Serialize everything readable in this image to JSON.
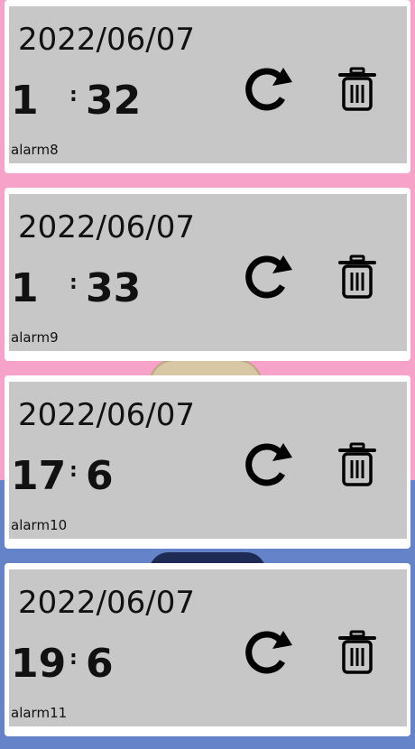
{
  "alarms": [
    {
      "date": "2022/06/07",
      "hour": "1",
      "separator": ":",
      "minute": "32",
      "label": "alarm8"
    },
    {
      "date": "2022/06/07",
      "hour": "1",
      "separator": ":",
      "minute": "33",
      "label": "alarm9"
    },
    {
      "date": "2022/06/07",
      "hour": "17",
      "separator": ":",
      "minute": "6",
      "label": "alarm10"
    },
    {
      "date": "2022/06/07",
      "hour": "19",
      "separator": ":",
      "minute": "6",
      "label": "alarm11"
    }
  ],
  "icons": {
    "reset": "refresh-icon",
    "delete": "trash-icon"
  },
  "colors": {
    "card": "#c7c7c7",
    "top_background": "#f7a2c8",
    "bottom_background": "#6483c8"
  }
}
